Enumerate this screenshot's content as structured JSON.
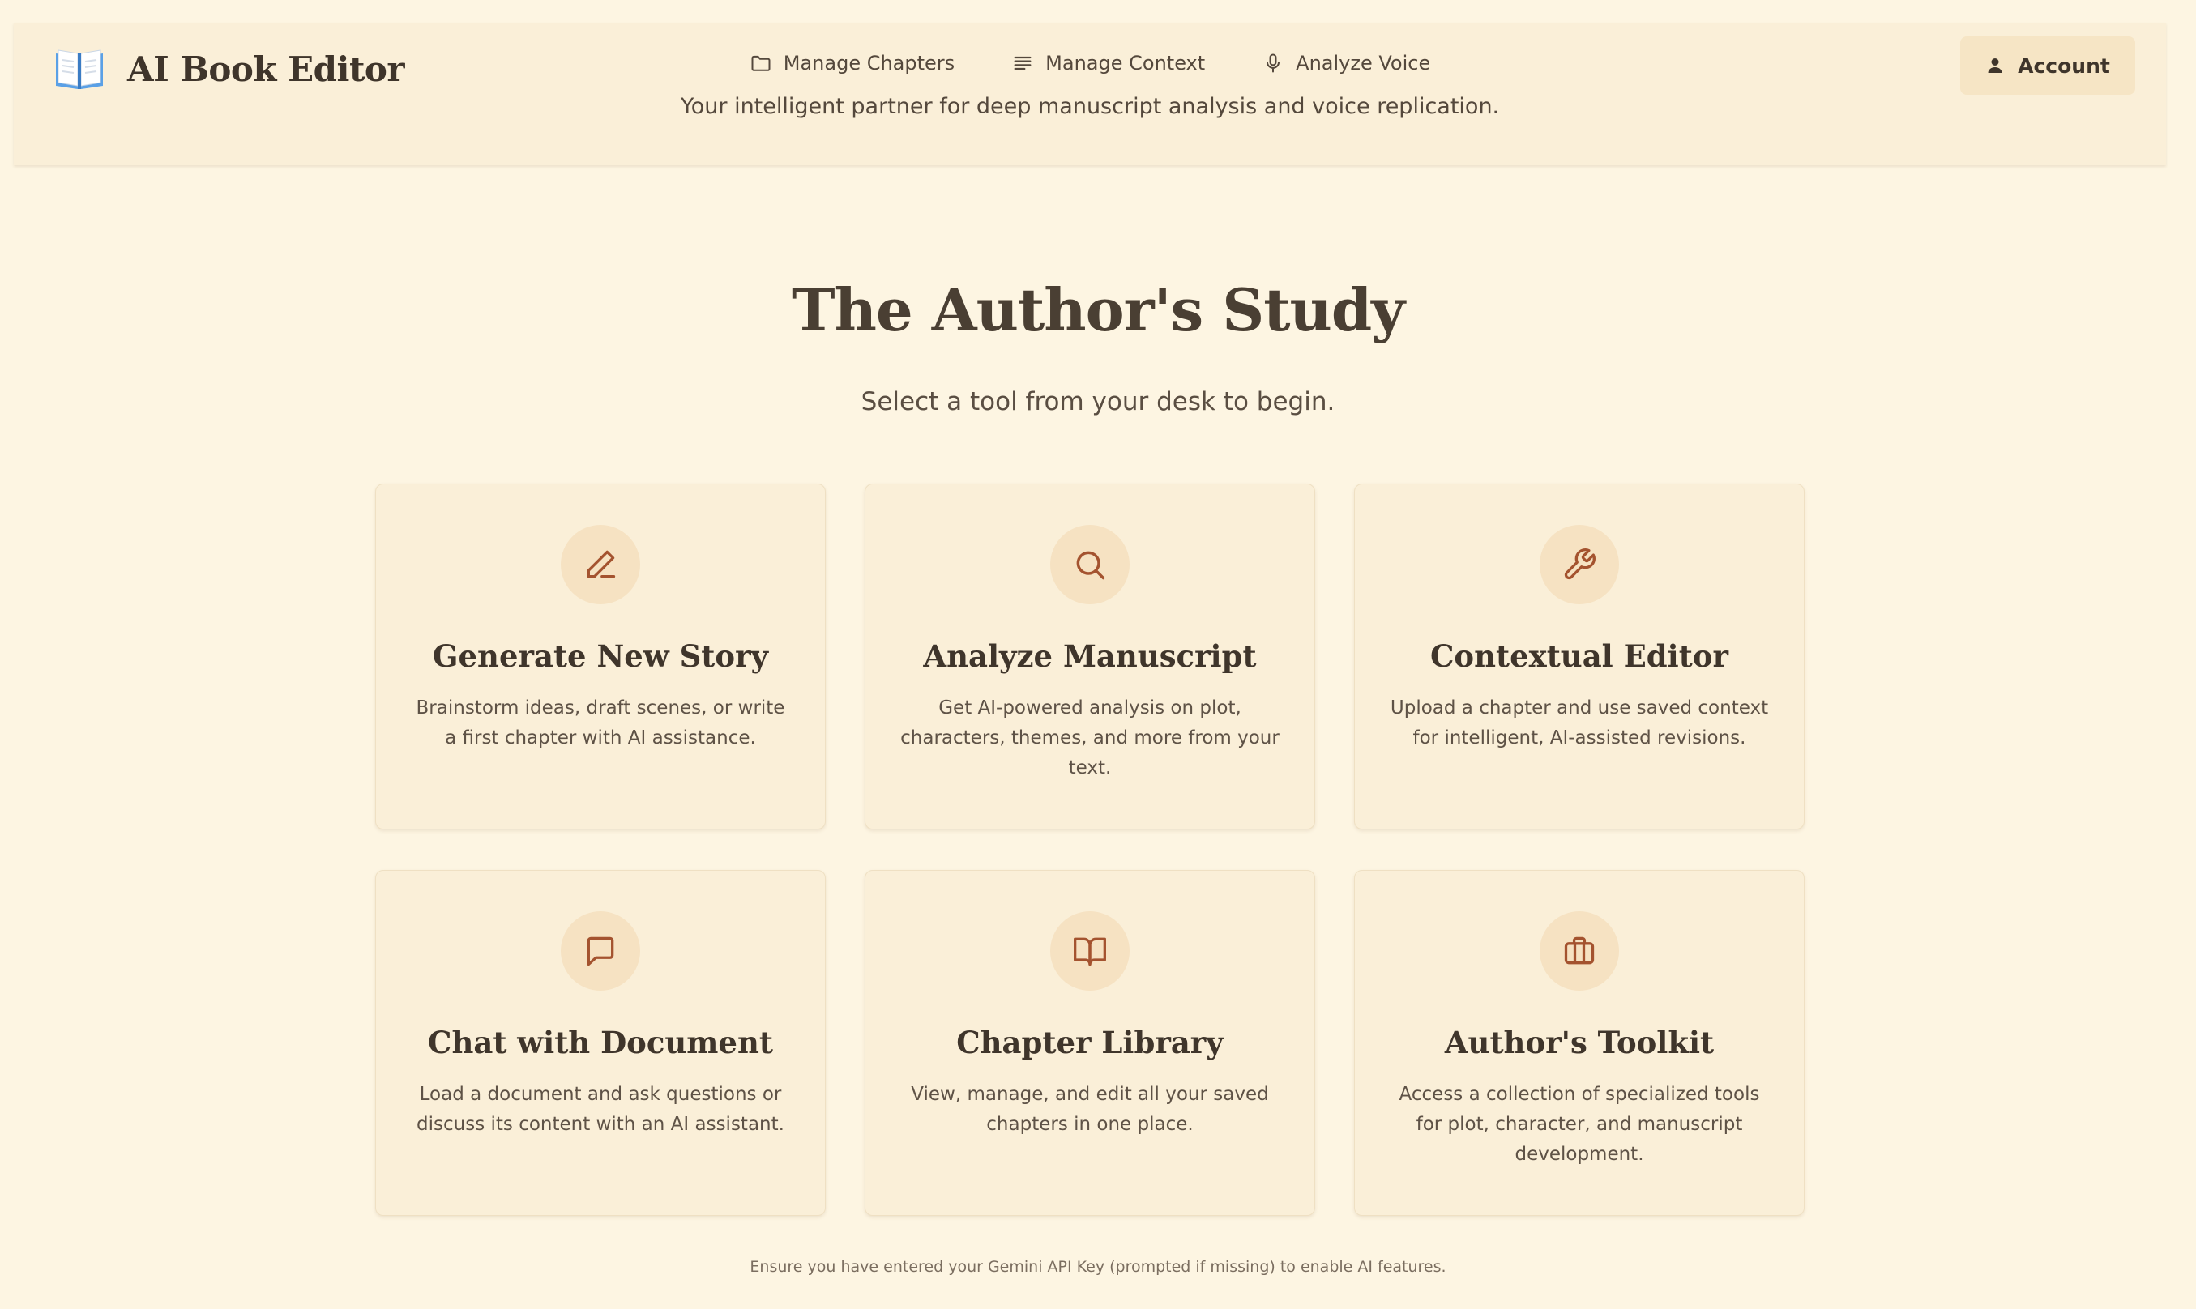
{
  "header": {
    "app_title": "AI Book Editor",
    "tagline": "Your intelligent partner for deep manuscript analysis and voice replication.",
    "nav": [
      {
        "label": "Manage Chapters",
        "icon": "folder-icon"
      },
      {
        "label": "Manage Context",
        "icon": "lines-icon"
      },
      {
        "label": "Analyze Voice",
        "icon": "microphone-icon"
      }
    ],
    "account_label": "Account"
  },
  "hero": {
    "title": "The Author's Study",
    "subtitle": "Select a tool from your desk to begin."
  },
  "cards": [
    {
      "title": "Generate New Story",
      "description": "Brainstorm ideas, draft scenes, or write a first chapter with AI assistance.",
      "icon": "pen-icon"
    },
    {
      "title": "Analyze Manuscript",
      "description": "Get AI-powered analysis on plot, characters, themes, and more from your text.",
      "icon": "search-icon"
    },
    {
      "title": "Contextual Editor",
      "description": "Upload a chapter and use saved context for intelligent, AI-assisted revisions.",
      "icon": "wrench-icon"
    },
    {
      "title": "Chat with Document",
      "description": "Load a document and ask questions or discuss its content with an AI assistant.",
      "icon": "chat-icon"
    },
    {
      "title": "Chapter Library",
      "description": "View, manage, and edit all your saved chapters in one place.",
      "icon": "open-book-icon"
    },
    {
      "title": "Author's Toolkit",
      "description": "Access a collection of specialized tools for plot, character, and manuscript development.",
      "icon": "briefcase-icon"
    }
  ],
  "footer_note": "Ensure you have entered your Gemini API Key (prompted if missing) to enable AI features.",
  "colors": {
    "background": "#fdf5e2",
    "panel": "#faefd8",
    "icon_circle": "#f6e2c2",
    "accent": "#a4532f",
    "text": "#3f352b"
  }
}
